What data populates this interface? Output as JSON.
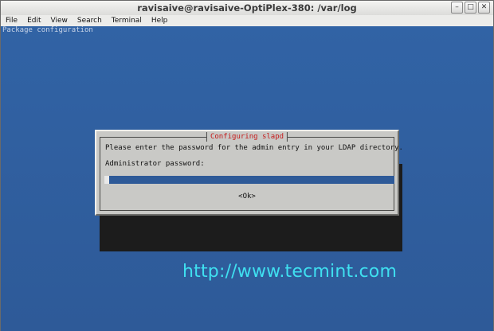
{
  "window": {
    "title": "ravisaive@ravisaive-OptiPlex-380: /var/log",
    "buttons": {
      "minimize": "–",
      "maximize": "□",
      "close": "✕"
    }
  },
  "menu": [
    {
      "label": "File"
    },
    {
      "label": "Edit"
    },
    {
      "label": "View"
    },
    {
      "label": "Search"
    },
    {
      "label": "Terminal"
    },
    {
      "label": "Help"
    }
  ],
  "terminal": {
    "header": "Package configuration"
  },
  "dialog": {
    "title": "Configuring slapd",
    "message": "Please enter the password for the admin entry in your LDAP directory.",
    "field_label": "Administrator password:",
    "field_value": "",
    "ok_label": "<Ok>"
  },
  "watermark": "http://www.tecmint.com",
  "colors": {
    "terminal_bg": "#305c9c",
    "dialog_bg": "#c9c9c6",
    "dialog_title": "#c41a1a",
    "watermark": "#3fe0f0"
  }
}
